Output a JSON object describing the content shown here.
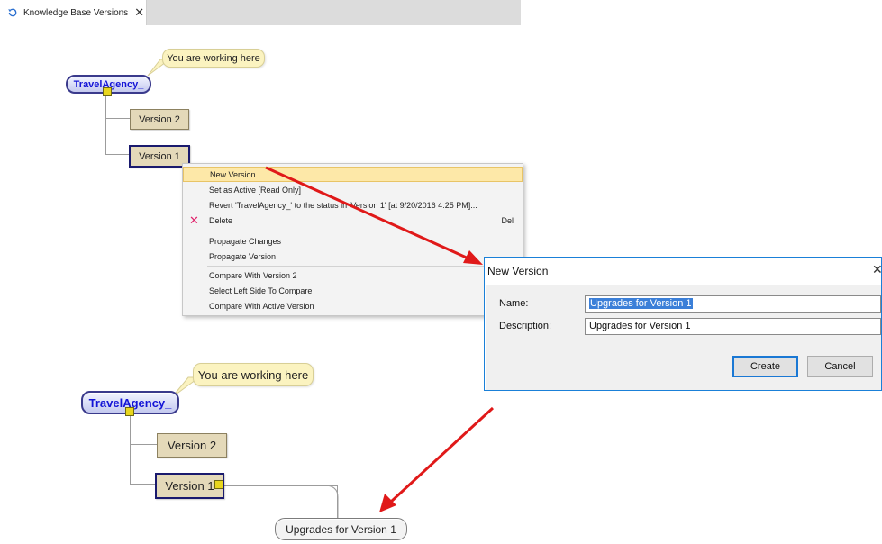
{
  "tab": {
    "icon": "history-icon",
    "title": "Knowledge Base Versions",
    "close": "✕"
  },
  "top": {
    "bubble": "You are working here",
    "kb_name": "TravelAgency_",
    "version2": "Version 2",
    "version1": "Version 1"
  },
  "context_menu": {
    "items": [
      {
        "label": "New Version",
        "shortcut": ""
      },
      {
        "label": "Set as Active [Read Only]",
        "shortcut": ""
      },
      {
        "label": "Revert 'TravelAgency_' to the status in 'Version 1' [at 9/20/2016 4:25 PM]...",
        "shortcut": ""
      },
      {
        "label": "Delete",
        "shortcut": "Del",
        "icon": "delete-x-icon"
      },
      {
        "label": "Propagate Changes",
        "shortcut": ""
      },
      {
        "label": "Propagate Version",
        "shortcut": ""
      },
      {
        "label": "Compare With Version 2",
        "shortcut": ""
      },
      {
        "label": "Select Left Side To Compare",
        "shortcut": ""
      },
      {
        "label": "Compare With Active Version",
        "shortcut": ""
      }
    ]
  },
  "dialog": {
    "title": "New Version",
    "close": "✕",
    "name_label": "Name:",
    "name_value": "Upgrades for Version 1",
    "description_label": "Description:",
    "description_value": "Upgrades for Version 1",
    "create_label": "Create",
    "cancel_label": "Cancel"
  },
  "bottom": {
    "bubble": "You are working here",
    "kb_name": "TravelAgency_",
    "version2": "Version 2",
    "version1": "Version 1",
    "new_version": "Upgrades for Version 1"
  },
  "colors": {
    "arrow": "#e01919",
    "menu_highlight": "#fde8a8",
    "kb_text": "#1414d6",
    "version_fill": "#e4d9b9",
    "bubble_fill": "#fbf3c0"
  }
}
